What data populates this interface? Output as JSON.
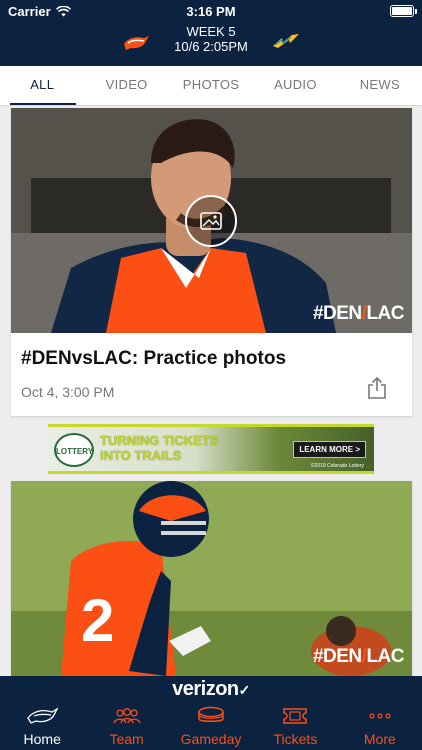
{
  "status": {
    "carrier": "Carrier",
    "time": "3:16 PM",
    "battery_level": 1.0
  },
  "game": {
    "week": "WEEK 5",
    "datetime": "10/6 2:05PM",
    "home_logo": "broncos-logo",
    "away_logo": "chargers-bolt-logo"
  },
  "tabs": [
    {
      "label": "ALL",
      "active": true
    },
    {
      "label": "VIDEO",
      "active": false
    },
    {
      "label": "PHOTOS",
      "active": false
    },
    {
      "label": "AUDIO",
      "active": false
    },
    {
      "label": "NEWS",
      "active": false
    }
  ],
  "cards": [
    {
      "title": "#DENvsLAC: Practice photos",
      "meta": "Oct 4, 3:00 PM",
      "badge": "#DEN/LAC",
      "icon": "photo-gallery-icon"
    },
    {
      "title": "",
      "meta": "",
      "badge": "DEN/LAC",
      "icon": ""
    }
  ],
  "badge_parts": {
    "left": "#DEN",
    "slash": "/",
    "right": "LAC"
  },
  "ad": {
    "logo_text": "LOTTERY",
    "headline_1": "TURNING TICKETS",
    "headline_2": "INTO TRAILS",
    "cta": "LEARN MORE >",
    "copyright": "©2019 Colorado Lottery"
  },
  "sponsor": {
    "name": "verizon",
    "mark": "✓"
  },
  "nav": [
    {
      "label": "Home",
      "icon": "broncos-head-icon",
      "active": true
    },
    {
      "label": "Team",
      "icon": "team-people-icon",
      "active": false
    },
    {
      "label": "Gameday",
      "icon": "stadium-icon",
      "active": false
    },
    {
      "label": "Tickets",
      "icon": "ticket-icon",
      "active": false
    },
    {
      "label": "More",
      "icon": "more-dots-icon",
      "active": false
    }
  ],
  "colors": {
    "navy": "#0b2341",
    "orange": "#fb4f14",
    "lime": "#c7d72b"
  }
}
